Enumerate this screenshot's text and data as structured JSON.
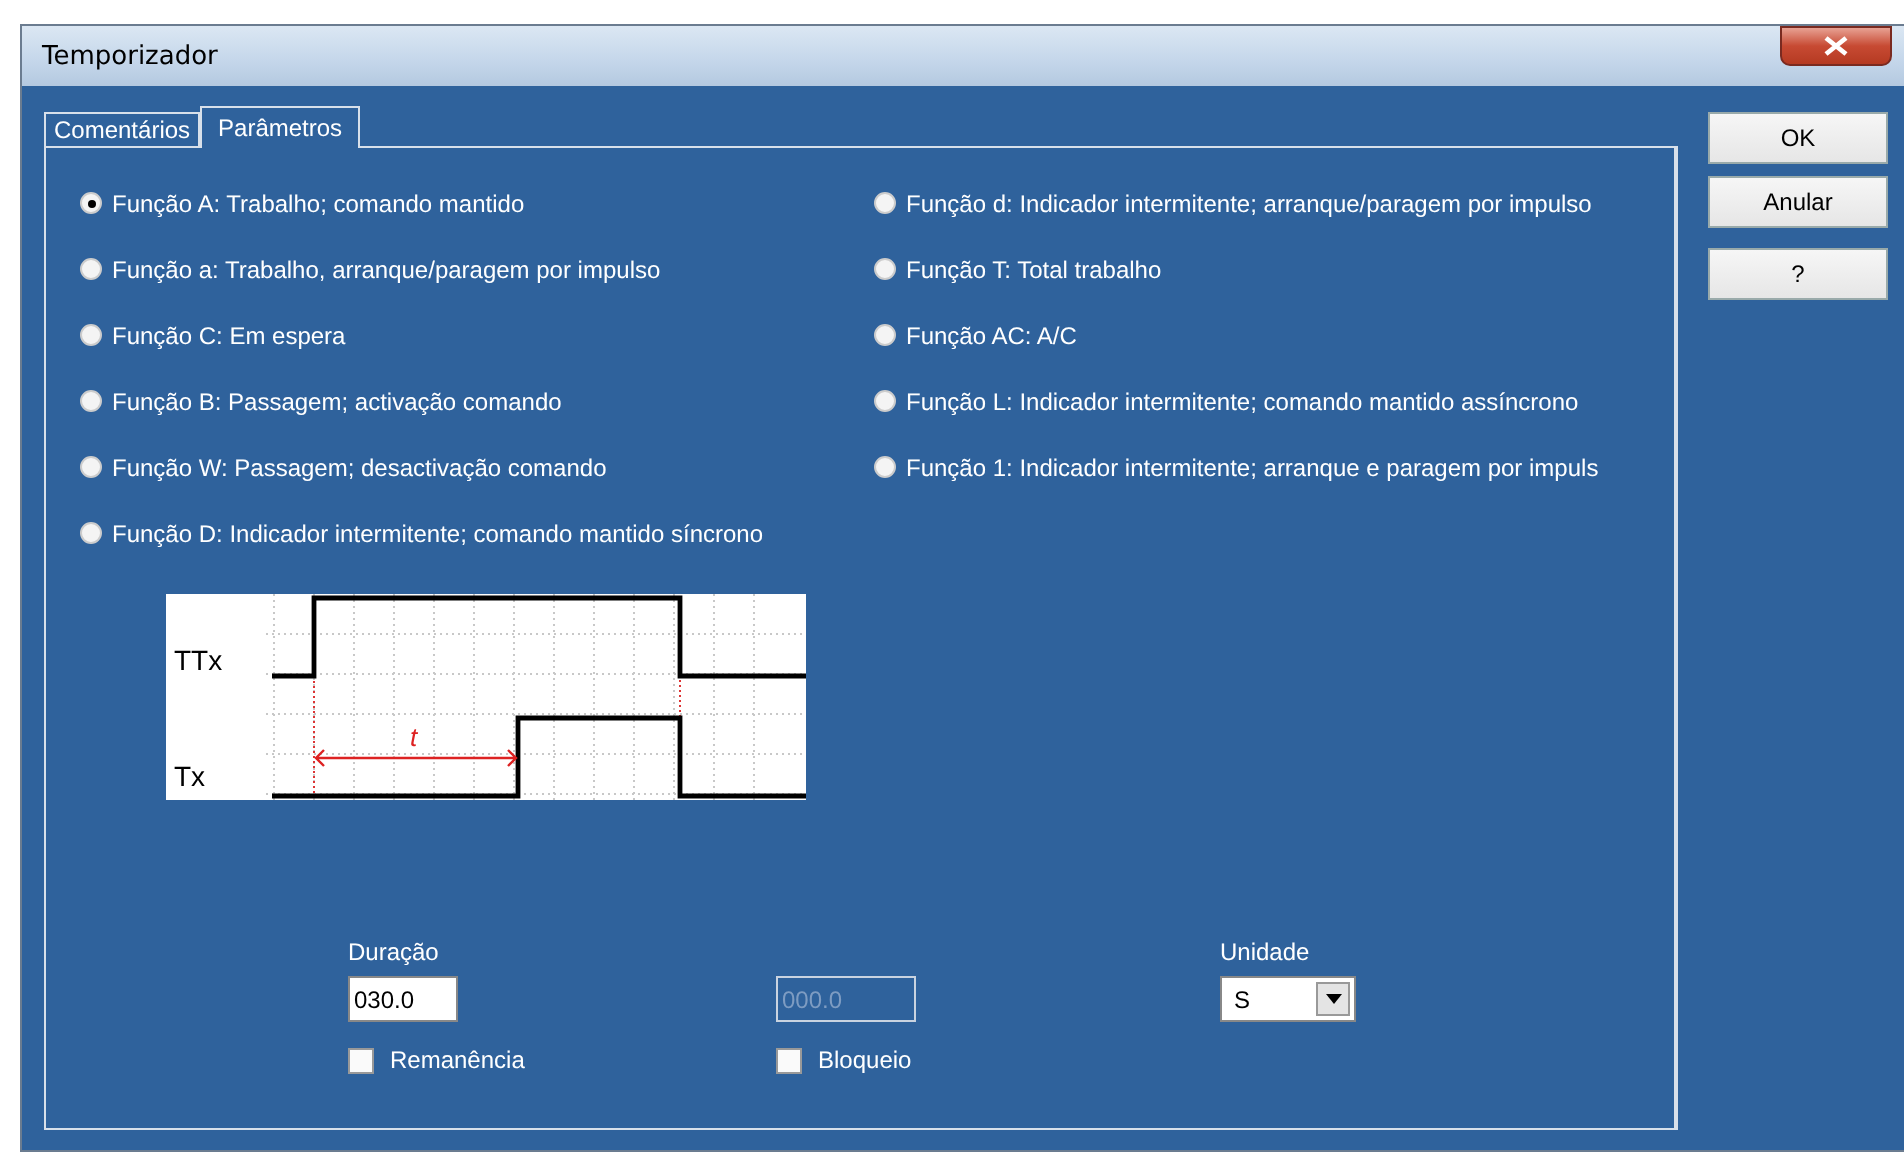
{
  "window": {
    "title": "Temporizador"
  },
  "tabs": [
    {
      "label": "Comentários",
      "selected": false
    },
    {
      "label": "Parâmetros",
      "selected": true
    }
  ],
  "function_columns": [
    {
      "options": [
        {
          "label": "Função A: Trabalho; comando mantido",
          "selected": true
        },
        {
          "label": "Função a: Trabalho, arranque/paragem por impulso",
          "selected": false
        },
        {
          "label": "Função C: Em espera",
          "selected": false
        },
        {
          "label": "Função B: Passagem; activação comando",
          "selected": false
        },
        {
          "label": "Função W: Passagem; desactivação comando",
          "selected": false
        },
        {
          "label": "Função D: Indicador intermitente; comando mantido síncrono",
          "selected": false
        }
      ]
    },
    {
      "options": [
        {
          "label": "Função d: Indicador intermitente; arranque/paragem por impulso",
          "selected": false
        },
        {
          "label": "Função T: Total trabalho",
          "selected": false
        },
        {
          "label": "Função AC: A/C",
          "selected": false
        },
        {
          "label": "Função L: Indicador intermitente; comando mantido assíncrono",
          "selected": false
        },
        {
          "label": "Função 1: Indicador intermitente; arranque e paragem por impuls",
          "selected": false
        }
      ]
    }
  ],
  "diagram": {
    "signals": [
      "TTx",
      "Tx"
    ],
    "time_label": "t"
  },
  "duration": {
    "label": "Duração",
    "value": "030.0"
  },
  "secondary_field": {
    "value": "000.0",
    "disabled": true
  },
  "unit": {
    "label": "Unidade",
    "value": "S"
  },
  "checkboxes": [
    {
      "label": "Remanência",
      "checked": false
    },
    {
      "label": "Bloqueio",
      "checked": false
    }
  ],
  "buttons": [
    "OK",
    "Anular",
    "?"
  ]
}
